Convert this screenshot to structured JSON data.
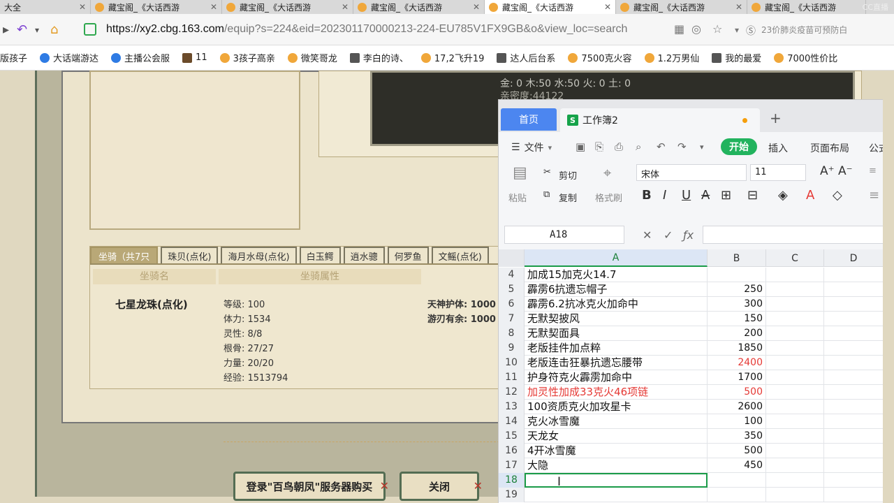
{
  "browser": {
    "tabs": [
      {
        "title": "大全"
      },
      {
        "title": "藏宝阁_《大话西游"
      },
      {
        "title": "藏宝阁_《大话西游"
      },
      {
        "title": "藏宝阁_《大话西游"
      },
      {
        "title": "藏宝阁_《大话西游"
      },
      {
        "title": "藏宝阁_《大话西游"
      },
      {
        "title": "藏宝阁_《大话西游"
      }
    ],
    "watermark": "CC直播",
    "url_host": "https://xy2.cbg.163.com",
    "url_rest": "/equip?s=224&eid=202301170000213-224-EU785V1FX9GB&o&view_loc=search",
    "news_text": "23价肺炎疫苗可预防白",
    "bookmarks": [
      {
        "label": "版孩子",
        "icon": "doc-icon"
      },
      {
        "label": "大话端游达",
        "icon": "blue"
      },
      {
        "label": "主播公会服",
        "icon": "blue"
      },
      {
        "label": "11",
        "icon": "sq"
      },
      {
        "label": "3孩子高亲",
        "icon": "orange"
      },
      {
        "label": "微笑哥龙",
        "icon": "orange"
      },
      {
        "label": "李白的诗、",
        "icon": "dark"
      },
      {
        "label": "17,2飞升19",
        "icon": "orange"
      },
      {
        "label": "达人后台系",
        "icon": "dark"
      },
      {
        "label": "7500克火容",
        "icon": "orange"
      },
      {
        "label": "1.2万男仙",
        "icon": "orange"
      },
      {
        "label": "我的最爱",
        "icon": "dark"
      },
      {
        "label": "7000性价比",
        "icon": "orange"
      }
    ]
  },
  "game": {
    "elements_line": "金: 0 木:50 水:50 火: 0 土: 0",
    "intimacy": "亲密度:44122",
    "mount_tabs": [
      "坐骑（共7只",
      "珠贝(点化)",
      "海月水母(点化)",
      "白玉鳄",
      "逍水骢",
      "何罗鱼",
      "文鳐(点化)"
    ],
    "mount_col_name": "坐骑名",
    "mount_col_attr": "坐骑属性",
    "mount_name": "七星龙珠(点化)",
    "attrs": [
      "等级: 100",
      "体力: 1534",
      "灵性: 8/8",
      "根骨: 27/27",
      "力量: 20/20",
      "经验: 1513794"
    ],
    "attrs2": [
      "天神护体: 1000",
      "游刃有余: 1000"
    ],
    "buy_button": "登录\"百鸟朝凤\"服务器购买",
    "close_button": "关闭"
  },
  "sheet": {
    "home_tab": "首页",
    "book_tab": "工作簿2",
    "menu": {
      "file": "文件",
      "start": "开始",
      "insert": "插入",
      "layout": "页面布局",
      "formula": "公式"
    },
    "ribbon": {
      "paste": "粘贴",
      "cut": "剪切",
      "copy": "复制",
      "format_painter": "格式刷",
      "font": "宋体",
      "size": "11"
    },
    "name_box": "A18",
    "columns": [
      "A",
      "B",
      "C",
      "D"
    ],
    "rows": [
      {
        "n": "4",
        "a": "加成15加克火14.7",
        "b": "",
        "red": false
      },
      {
        "n": "5",
        "a": "霹雳6抗遗忘帽子",
        "b": "250",
        "red": false
      },
      {
        "n": "6",
        "a": "霹雳6.2抗冰克火加命中",
        "b": "300",
        "red": false
      },
      {
        "n": "7",
        "a": "无默契披风",
        "b": "150",
        "red": false
      },
      {
        "n": "8",
        "a": "无默契面具",
        "b": "200",
        "red": false
      },
      {
        "n": "9",
        "a": "老版挂件加点粹",
        "b": "1850",
        "red": false
      },
      {
        "n": "10",
        "a": "老版连击狂暴抗遗忘腰带",
        "b": "2400",
        "red": "b"
      },
      {
        "n": "11",
        "a": "护身符克火霹雳加命中",
        "b": "1700",
        "red": false
      },
      {
        "n": "12",
        "a": "加灵性加成33克火46项链",
        "b": "500",
        "red": "ab"
      },
      {
        "n": "13",
        "a": "100资质克火加攻星卡",
        "b": "2600",
        "red": false
      },
      {
        "n": "14",
        "a": "克火冰雪魔",
        "b": "100",
        "red": false
      },
      {
        "n": "15",
        "a": "天龙女",
        "b": "350",
        "red": false
      },
      {
        "n": "16",
        "a": "4开冰雪魔",
        "b": "500",
        "red": false
      },
      {
        "n": "17",
        "a": "大隐",
        "b": "450",
        "red": false
      },
      {
        "n": "18",
        "a": "",
        "b": "",
        "red": false
      },
      {
        "n": "19",
        "a": "",
        "b": "",
        "red": false
      }
    ]
  }
}
